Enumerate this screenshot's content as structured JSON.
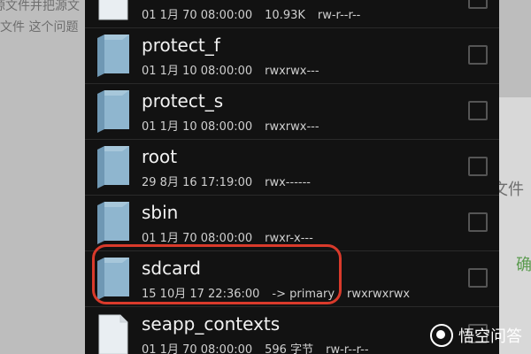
{
  "background": {
    "line1": "源文件并把源文",
    "line2": "文件 这个问题",
    "side_text": "文件",
    "side_green": "确"
  },
  "files": [
    {
      "name": "",
      "date": "01 1月 70 08:00:00",
      "size": "10.93K",
      "perms": "rw-r--r--",
      "type": "file"
    },
    {
      "name": "protect_f",
      "date": "01 1月 10 08:00:00",
      "size": "",
      "perms": "rwxrwx---",
      "type": "folder"
    },
    {
      "name": "protect_s",
      "date": "01 1月 10 08:00:00",
      "size": "",
      "perms": "rwxrwx---",
      "type": "folder"
    },
    {
      "name": "root",
      "date": "29 8月 16 17:19:00",
      "size": "",
      "perms": "rwx------",
      "type": "folder"
    },
    {
      "name": "sbin",
      "date": "01 1月 70 08:00:00",
      "size": "",
      "perms": "rwxr-x---",
      "type": "folder"
    },
    {
      "name": "sdcard",
      "date": "15 10月 17 22:36:00",
      "size": "-> primary",
      "perms": "rwxrwxrwx",
      "type": "folder"
    },
    {
      "name": "seapp_contexts",
      "date": "01 1月 70 08:00:00",
      "size": "596 字节",
      "perms": "rw-r--r--",
      "type": "file"
    }
  ],
  "highlighted_item": "sdcard",
  "watermark": "悟空问答",
  "colors": {
    "highlight": "#d93a2b",
    "list_bg": "#121212",
    "folder": "#8fb6cf"
  }
}
